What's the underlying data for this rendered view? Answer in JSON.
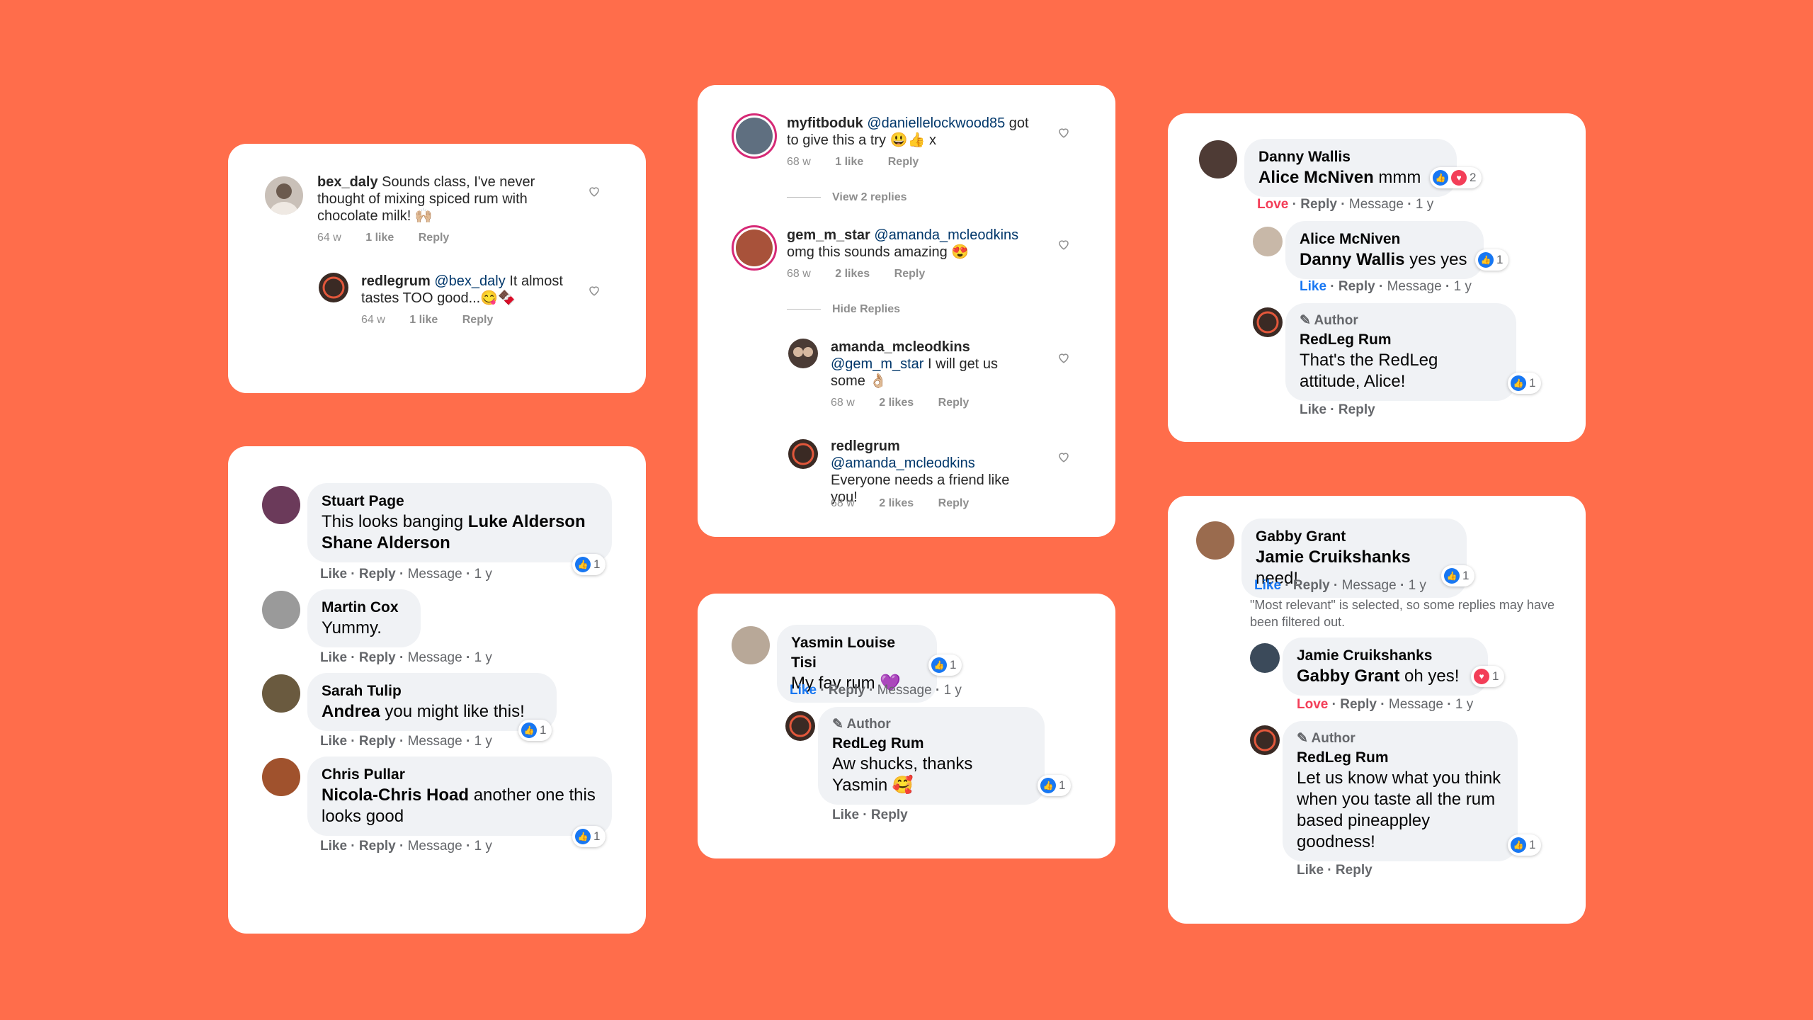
{
  "colors": {
    "background": "#FF6D4B",
    "ig_mention": "#00376b",
    "fb_like": "#1877f2",
    "fb_love": "#f33e58"
  },
  "ig_card_1": {
    "c1": {
      "user": "bex_daly",
      "text": "Sounds class, I've never thought of mixing spiced rum with chocolate milk! 🙌🏼",
      "time": "64 w",
      "likes": "1 like",
      "reply": "Reply"
    },
    "c2": {
      "user": "redlegrum",
      "mention": "@bex_daly",
      "text": "It almost tastes TOO good...😋🍫",
      "time": "64 w",
      "likes": "1 like",
      "reply": "Reply"
    }
  },
  "ig_card_2": {
    "c1": {
      "user": "myfitboduk",
      "mention": "@daniellelockwood85",
      "text": "got to give this a try 😃👍 x",
      "time": "68 w",
      "likes": "1 like",
      "reply": "Reply"
    },
    "view_replies": "View 2 replies",
    "c2": {
      "user": "gem_m_star",
      "mention": "@amanda_mcleodkins",
      "text": "omg this sounds amazing 😍",
      "time": "68 w",
      "likes": "2 likes",
      "reply": "Reply"
    },
    "hide_replies": "Hide Replies",
    "c3": {
      "user": "amanda_mcleodkins",
      "mention": "@gem_m_star",
      "text": "I will get us some 👌🏼",
      "time": "68 w",
      "likes": "2 likes",
      "reply": "Reply"
    },
    "c4": {
      "user": "redlegrum",
      "mention": "@amanda_mcleodkins",
      "text": "Everyone needs a friend like you!",
      "time": "68 w",
      "likes": "2 likes",
      "reply": "Reply"
    }
  },
  "fb_card_1": {
    "c1": {
      "name": "Stuart Page",
      "text_pre": "This looks banging ",
      "tag": "Luke Alderson Shane Alderson",
      "count": "1"
    },
    "c2": {
      "name": "Martin Cox",
      "text": "Yummy."
    },
    "c3": {
      "name": "Sarah Tulip",
      "tag": "Andrea",
      "text": " you might like this!",
      "count": "1"
    },
    "c4": {
      "name": "Chris Pullar",
      "tag": "Nicola-Chris Hoad",
      "text": " another one this looks good",
      "count": "1"
    },
    "meta": {
      "like": "Like",
      "reply": "Reply",
      "message": "Message",
      "time": "1 y"
    }
  },
  "fb_card_2": {
    "c1": {
      "name": "Yasmin Louise Tisi",
      "text": "My fav rum 💜",
      "count": "1"
    },
    "c2": {
      "author": "Author",
      "name": "RedLeg Rum",
      "text": "Aw shucks, thanks Yasmin 🥰",
      "count": "1"
    },
    "meta": {
      "like": "Like",
      "reply": "Reply",
      "message": "Message",
      "time": "1 y"
    }
  },
  "fb_card_3": {
    "c1": {
      "name": "Danny Wallis",
      "tag": "Alice McNiven",
      "text": " mmm",
      "count": "2",
      "love": "Love"
    },
    "c2": {
      "name": "Alice McNiven",
      "tag": "Danny Wallis",
      "text": " yes yes",
      "count": "1"
    },
    "c3": {
      "author": "Author",
      "name": "RedLeg Rum",
      "text": "That's the RedLeg attitude, Alice!",
      "count": "1"
    },
    "meta": {
      "like": "Like",
      "reply": "Reply",
      "message": "Message",
      "time": "1 y"
    }
  },
  "fb_card_4": {
    "c1": {
      "name": "Gabby Grant",
      "tag": "Jamie Cruikshanks",
      "text": " need!",
      "count": "1"
    },
    "note": "\"Most relevant\" is selected, so some replies may have been filtered out.",
    "c2": {
      "name": "Jamie Cruikshanks",
      "tag": "Gabby Grant",
      "text": " oh yes!",
      "count": "1",
      "love": "Love"
    },
    "c3": {
      "author": "Author",
      "name": "RedLeg Rum",
      "text": "Let us know what you think when you taste all the rum based pineappley goodness!",
      "count": "1"
    },
    "meta": {
      "like": "Like",
      "reply": "Reply",
      "message": "Message",
      "time": "1 y"
    }
  }
}
